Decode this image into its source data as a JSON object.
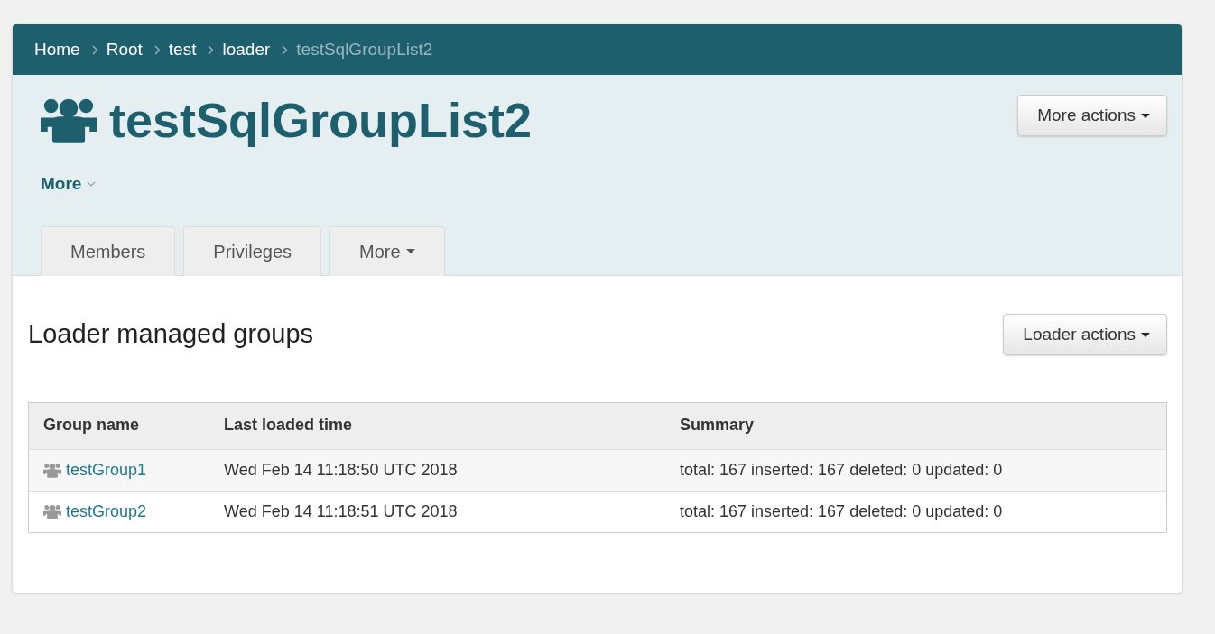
{
  "breadcrumb": [
    {
      "label": "Home",
      "current": false
    },
    {
      "label": "Root",
      "current": false
    },
    {
      "label": "test",
      "current": false
    },
    {
      "label": "loader",
      "current": false
    },
    {
      "label": "testSqlGroupList2",
      "current": true
    }
  ],
  "header": {
    "title": "testSqlGroupList2",
    "more_link": "More",
    "more_actions": "More actions"
  },
  "tabs": [
    {
      "label": "Members",
      "selected": false,
      "dropdown": false
    },
    {
      "label": "Privileges",
      "selected": false,
      "dropdown": false
    },
    {
      "label": "More",
      "selected": false,
      "dropdown": true
    }
  ],
  "section": {
    "title": "Loader managed groups",
    "actions": "Loader actions"
  },
  "table": {
    "columns": [
      "Group name",
      "Last loaded time",
      "Summary"
    ],
    "rows": [
      {
        "group": "testGroup1",
        "time": "Wed Feb 14 11:18:50 UTC 2018",
        "summary": "total: 167 inserted: 167 deleted: 0 updated: 0"
      },
      {
        "group": "testGroup2",
        "time": "Wed Feb 14 11:18:51 UTC 2018",
        "summary": "total: 167 inserted: 167 deleted: 0 updated: 0"
      }
    ]
  }
}
